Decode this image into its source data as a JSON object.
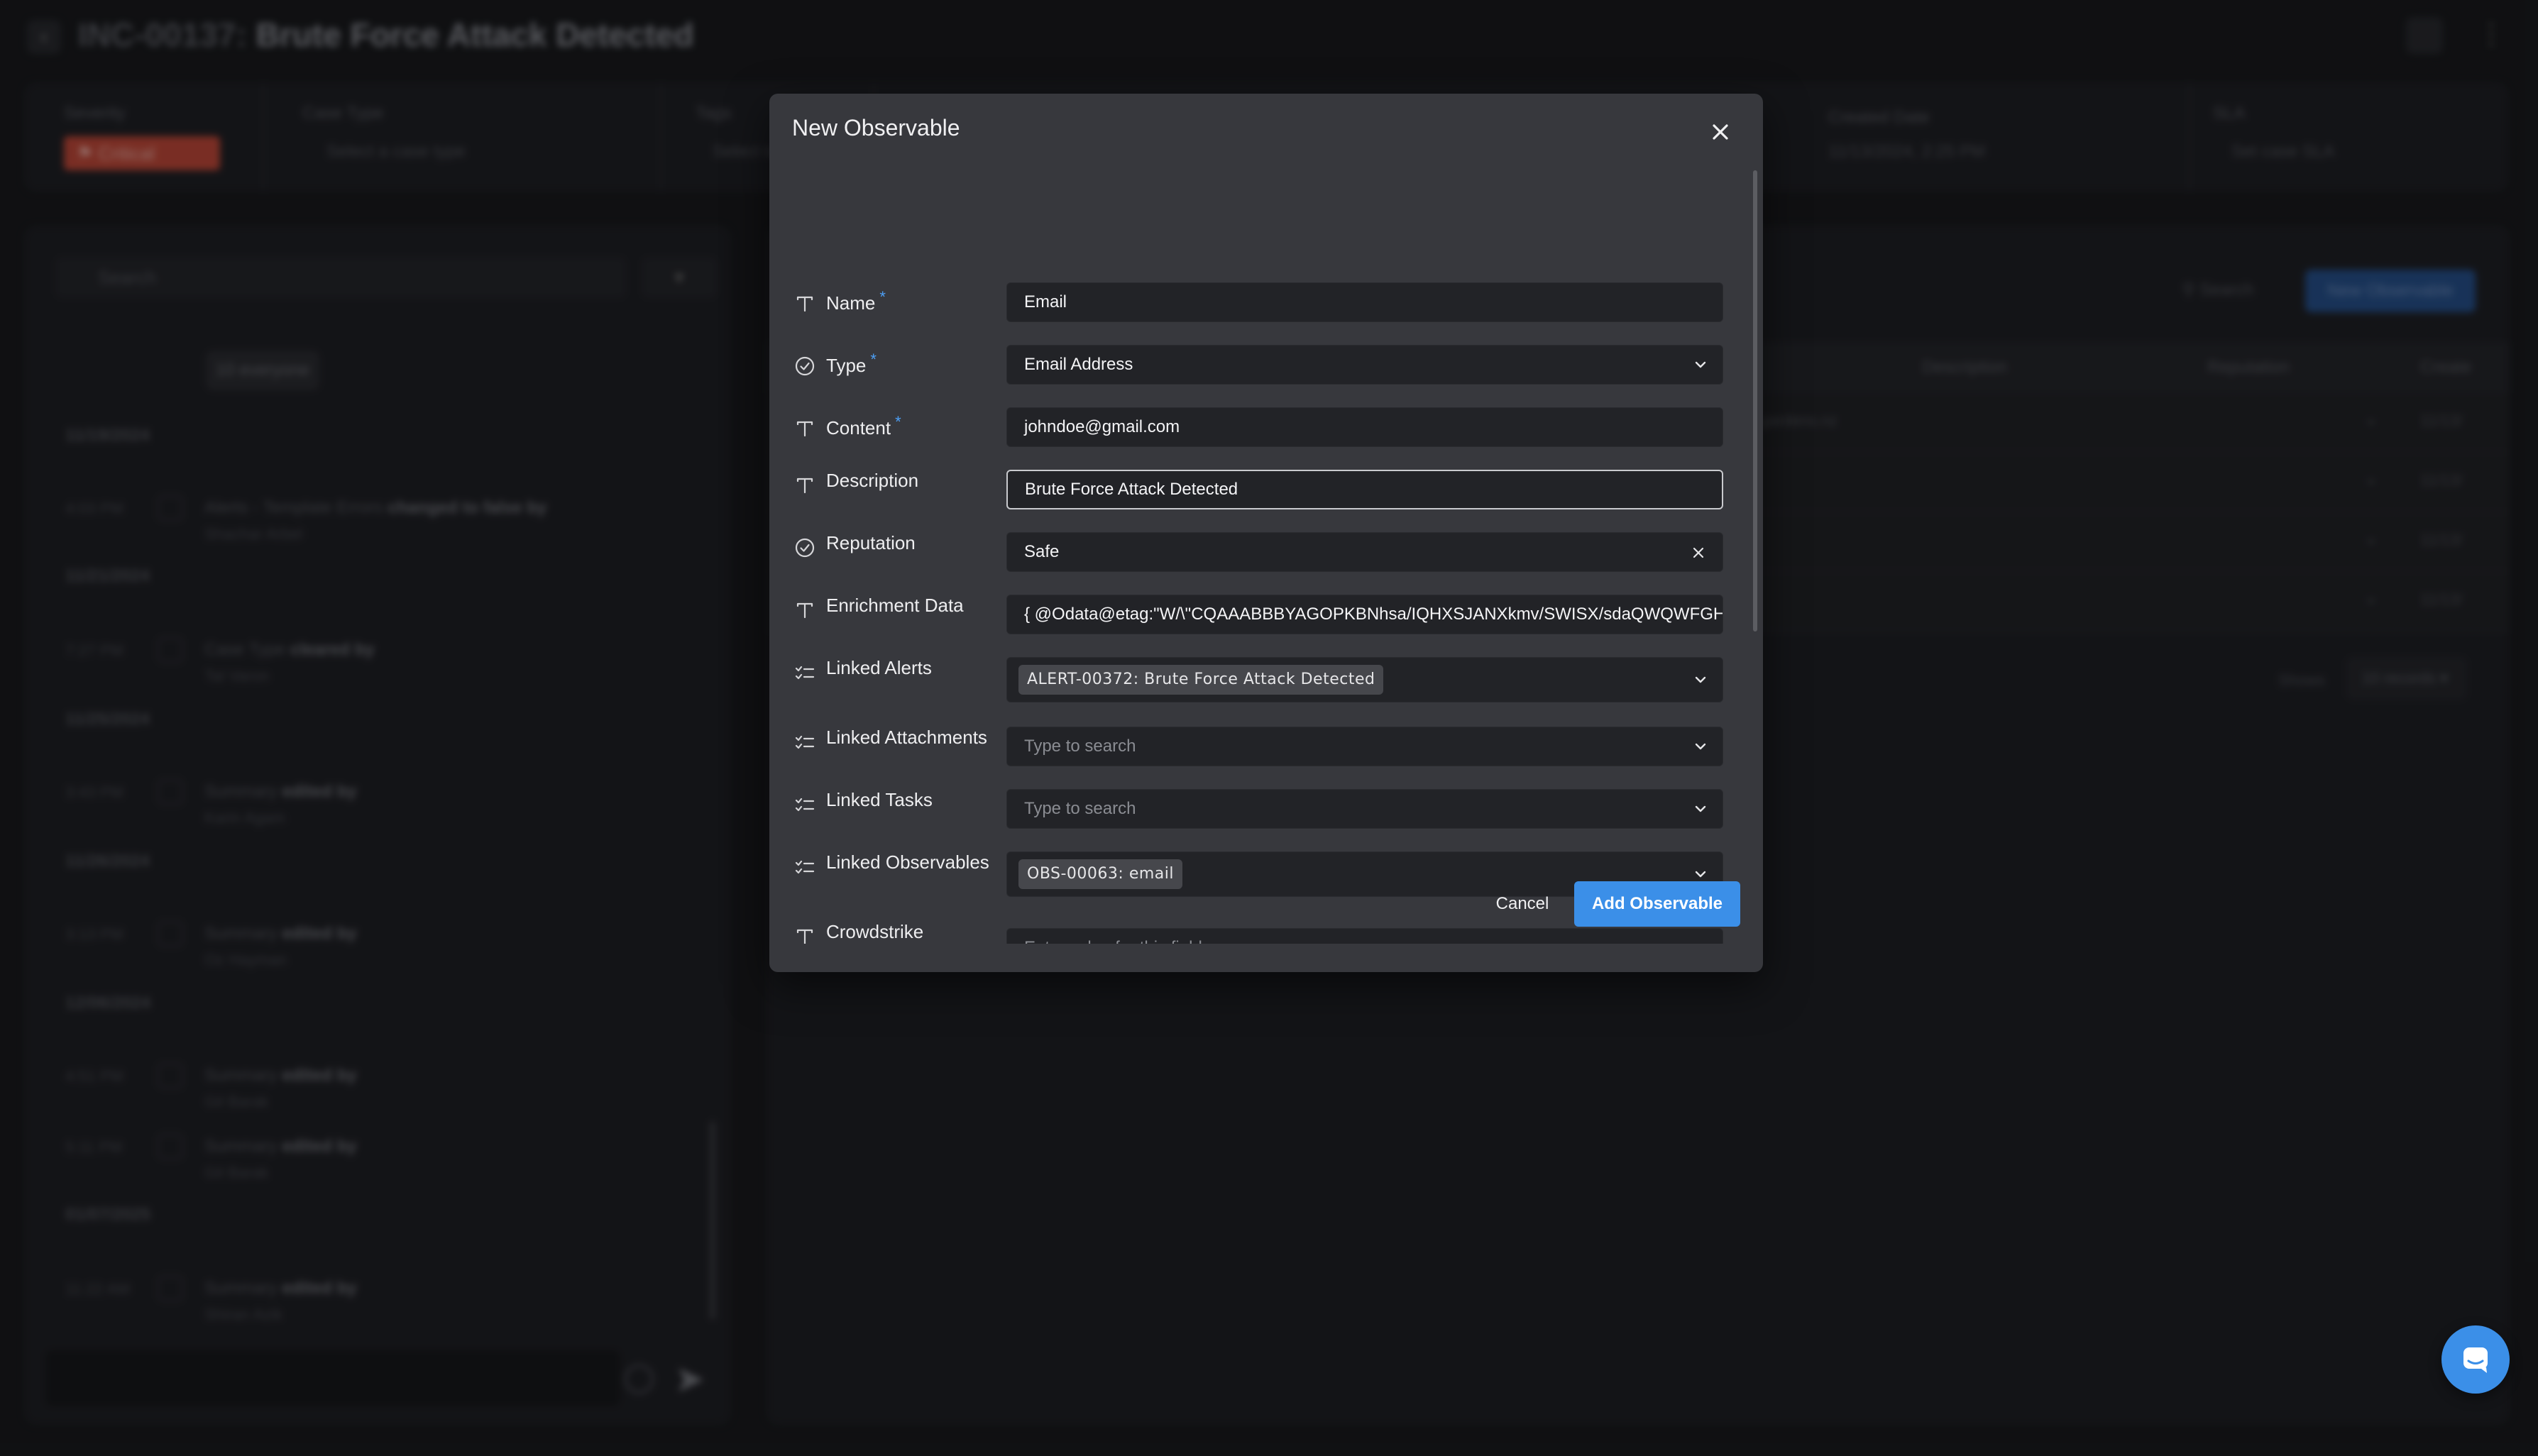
{
  "background": {
    "incident_id": "INC-00137:",
    "incident_title": "Brute Force Attack Detected",
    "meta": [
      {
        "label": "Severity",
        "value": "Critical"
      },
      {
        "label": "Case Type",
        "value": "Select a case type"
      },
      {
        "label": "Tags",
        "value": "Select tags"
      },
      {
        "label": "Created Date",
        "value": "11/13/2024, 2:25 PM"
      },
      {
        "label": "SLA",
        "value": "Set case SLA"
      }
    ],
    "activity": {
      "search_placeholder": "Search",
      "chip": "10 everyone",
      "dates": [
        "11/19/2024",
        "11/21/2024",
        "11/25/2024",
        "11/26/2024",
        "12/06/2024",
        "01/07/2025"
      ],
      "events": [
        {
          "time": "4:03 PM",
          "text": "Alerts - Template Errors",
          "action": "changed to false by",
          "user": "Shachar Arbel"
        },
        {
          "time": "7:27 PM",
          "text": "Case Type",
          "action": "cleared by",
          "user": "Tal Varon"
        },
        {
          "time": "3:43 PM",
          "text": "Summary",
          "action": "edited by",
          "user": "Karin Agam"
        },
        {
          "time": "3:13 PM",
          "text": "Summary",
          "action": "edited by",
          "user": "Oz Hayman"
        },
        {
          "time": "4:51 PM",
          "text": "Summary",
          "action": "edited by",
          "user": "Gil Barak"
        },
        {
          "time": "5:11 PM",
          "text": "Summary",
          "action": "edited by",
          "user": "Gil Barak"
        },
        {
          "time": "11:22 AM",
          "text": "Summary",
          "action": "edited by",
          "user": "Shiran Azik"
        }
      ]
    },
    "table": {
      "search_label": "Search",
      "new_button": "New Observable",
      "columns": [
        "Description",
        "Reputation",
        "Create"
      ],
      "rows": [
        {
          "name": "gardens.nz",
          "date": "11/13/"
        },
        {
          "name": "",
          "date": "11/13/"
        },
        {
          "name": "",
          "date": "11/13/"
        },
        {
          "name": "",
          "date": "11/13/"
        }
      ],
      "pager_label": "Shows",
      "pager_value": "10 records"
    }
  },
  "modal": {
    "title": "New Observable",
    "fields": {
      "name": {
        "label": "Name",
        "value": "Email",
        "required": "*"
      },
      "type": {
        "label": "Type",
        "value": "Email Address",
        "required": "*"
      },
      "content": {
        "label": "Content",
        "value": "johndoe@gmail.com",
        "required": "*"
      },
      "description": {
        "label": "Description",
        "value": "Brute Force Attack Detected"
      },
      "reputation": {
        "label": "Reputation",
        "value": "Safe"
      },
      "enrichment": {
        "label": "Enrichment Data",
        "value": "{ @Odata@etag:\"W/\\\"CQAAABBBYAGOPKBNhsa/IQHXSJANXkmv/SWISX/sdaQWQWFGHW"
      },
      "linked_alerts": {
        "label": "Linked Alerts",
        "tag": "ALERT-00372: Brute Force Attack Detected"
      },
      "linked_attachments": {
        "label": "Linked Attachments",
        "placeholder": "Type to search"
      },
      "linked_tasks": {
        "label": "Linked Tasks",
        "placeholder": "Type to search"
      },
      "linked_observables": {
        "label": "Linked Observables",
        "tag": "OBS-00063: email"
      },
      "crowdstrike": {
        "label": "Crowdstrike",
        "placeholder": "Enter value for this field"
      }
    },
    "cancel_label": "Cancel",
    "submit_label": "Add Observable"
  },
  "icons": {
    "close": "close-icon",
    "text_field": "text-field-icon",
    "select_field": "check-circle-icon",
    "list_field": "checklist-icon",
    "chevron": "chevron-down-icon",
    "chat": "chat-icon"
  },
  "colors": {
    "accent": "#3b8fe8",
    "required": "#4d9ff5",
    "modal_bg": "#37383d",
    "input_bg": "#222327",
    "critical": "#c44a3a"
  }
}
